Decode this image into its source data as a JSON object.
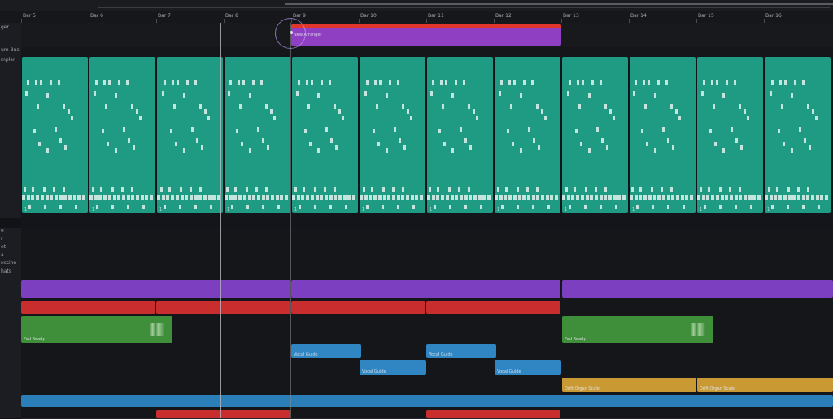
{
  "ruler": {
    "bars": [
      "Bar 5",
      "Bar 6",
      "Bar 7",
      "Bar 8",
      "Bar 9",
      "Bar 10",
      "Bar 11",
      "Bar 12",
      "Bar 13",
      "Bar 14",
      "Bar 15",
      "Bar 16"
    ]
  },
  "tracks": [
    {
      "label": "ger"
    },
    {
      "label": "um Bus"
    },
    {
      "label": "mpler"
    },
    {
      "label": "e"
    },
    {
      "label": "r"
    },
    {
      "label": "et"
    },
    {
      "label": "a"
    },
    {
      "label": "ussion"
    },
    {
      "label": "hats"
    }
  ],
  "regions": {
    "arranger_label": "New Arranger",
    "sampler_label": "1",
    "pad_label": "Pad",
    "green_label": "Pad Ready",
    "blue_label": "Vocal Guide",
    "blue_alt_label": "Vocal Guide",
    "gold_label": "Drift Organ Scale"
  },
  "colors": {
    "arranger": "#8e3fc2",
    "arranger_top": "#e0372a",
    "sampler": "#1f9a83",
    "purple_lane": "#7b3fc0",
    "red_lane": "#c92d2d",
    "green": "#3f8f3a",
    "blue": "#2f86c2",
    "gold": "#c99a34",
    "bottom_blue": "#2a7fb8",
    "playhead": "#b8b8c0"
  }
}
